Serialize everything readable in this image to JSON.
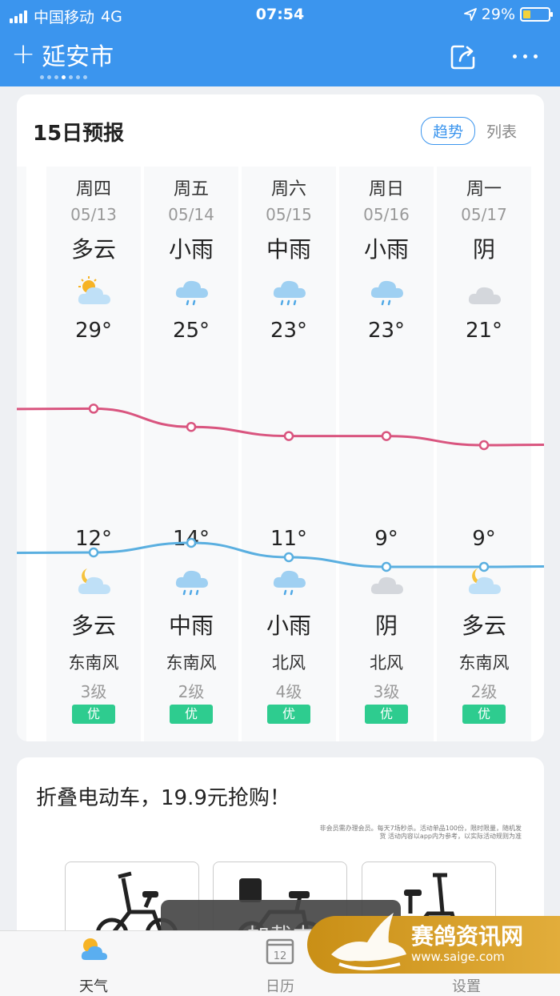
{
  "status": {
    "carrier": "中国移动",
    "network": "4G",
    "time": "07:54",
    "battery": "29%",
    "battery_level": 0.29
  },
  "header": {
    "city": "延安市",
    "plus": "+",
    "page_count": 7,
    "active_page": 3
  },
  "forecast": {
    "title": "15日预报",
    "toggle_active": "趋势",
    "toggle_inactive": "列表",
    "days": [
      {
        "day": "周四",
        "date": "05/13",
        "day_weather": "多云",
        "day_icon": "partly-cloudy-icon",
        "high": "29°",
        "low": "12°",
        "night_icon": "partly-cloudy-night-icon",
        "night_weather": "多云",
        "wind": "东南风",
        "level": "3级",
        "aqi": "优"
      },
      {
        "day": "周五",
        "date": "05/14",
        "day_weather": "小雨",
        "day_icon": "light-rain-icon",
        "high": "25°",
        "low": "14°",
        "night_icon": "moderate-rain-icon",
        "night_weather": "中雨",
        "wind": "东南风",
        "level": "2级",
        "aqi": "优"
      },
      {
        "day": "周六",
        "date": "05/15",
        "day_weather": "中雨",
        "day_icon": "moderate-rain-icon",
        "high": "23°",
        "low": "11°",
        "night_icon": "light-rain-icon",
        "night_weather": "小雨",
        "wind": "北风",
        "level": "4级",
        "aqi": "优"
      },
      {
        "day": "周日",
        "date": "05/16",
        "day_weather": "小雨",
        "day_icon": "light-rain-icon",
        "high": "23°",
        "low": "9°",
        "night_icon": "overcast-icon",
        "night_weather": "阴",
        "wind": "北风",
        "level": "3级",
        "aqi": "优"
      },
      {
        "day": "周一",
        "date": "05/17",
        "day_weather": "阴",
        "day_icon": "overcast-icon",
        "high": "21°",
        "low": "9°",
        "night_icon": "partly-cloudy-night-icon",
        "night_weather": "多云",
        "wind": "东南风",
        "level": "2级",
        "aqi": "优"
      }
    ],
    "high_values": [
      29,
      25,
      23,
      23,
      21
    ],
    "low_values": [
      12,
      14,
      11,
      9,
      9
    ],
    "colors": {
      "high_line": "#d9557f",
      "low_line": "#5aafe0",
      "aqi_good": "#2ecc8f",
      "accent": "#3b95ee"
    }
  },
  "ad": {
    "title": "折叠电动车，19.9元抢购！",
    "fine_print": "非会员需办理会员。每天7场秒杀。活动单品100份，限时限量，随机发货 活动内容以app内为参考，以实际活动规则为准",
    "toast_text": "加载中"
  },
  "tabbar": {
    "items": [
      {
        "label": "天气",
        "icon": "weather-icon",
        "active": true
      },
      {
        "label": "日历",
        "icon": "calendar-icon",
        "calendar_day": "12",
        "active": false
      },
      {
        "label": "设置",
        "icon": "settings-icon",
        "active": false
      }
    ]
  },
  "watermark": {
    "name": "赛鸽资讯网",
    "url": "www.saige.com"
  }
}
